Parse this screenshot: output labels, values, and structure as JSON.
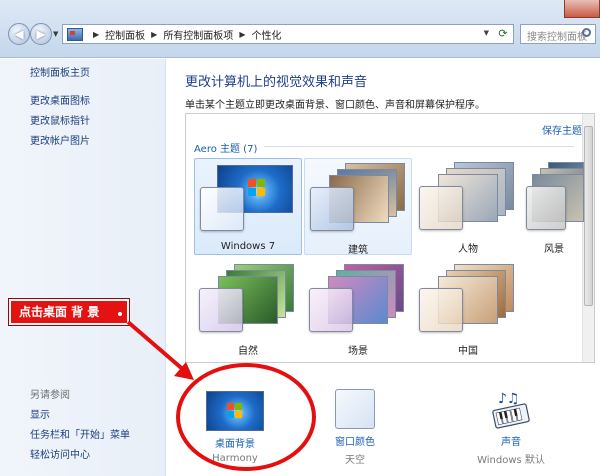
{
  "address_bar": {
    "breadcrumbs": [
      "控制面板",
      "所有控制面板项",
      "个性化"
    ],
    "search_placeholder": "搜索控制面板"
  },
  "sidebar": {
    "home_link": "控制面板主页",
    "links": [
      "更改桌面图标",
      "更改鼠标指针",
      "更改帐户图片"
    ],
    "see_also_title": "另请参阅",
    "see_also": [
      "显示",
      "任务栏和「开始」菜单",
      "轻松访问中心"
    ]
  },
  "main": {
    "heading": "更改计算机上的视觉效果和声音",
    "subheading": "单击某个主题立即更改桌面背景、窗口颜色、声音和屏幕保护程序。",
    "save_theme": "保存主题",
    "aero_label": "Aero 主题 (7)",
    "themes": [
      {
        "name": "Windows 7",
        "selected": true,
        "colors": [
          "#1d6cc8",
          "#54a6ee"
        ]
      },
      {
        "name": "建筑",
        "colors": [
          "#8a6a4a",
          "#d8c0a0"
        ]
      },
      {
        "name": "人物",
        "colors": [
          "#9aa7b8",
          "#e6d8c6"
        ]
      },
      {
        "name": "风景",
        "colors": [
          "#3a5a7a",
          "#c9c2b0"
        ]
      },
      {
        "name": "自然",
        "colors": [
          "#3a7a3a",
          "#9ad07a"
        ]
      },
      {
        "name": "场景",
        "colors": [
          "#6a4a8a",
          "#d08ac0"
        ]
      },
      {
        "name": "中国",
        "colors": [
          "#c08a5a",
          "#f0e0c8"
        ]
      }
    ]
  },
  "bottom": {
    "desktop_background": {
      "label": "桌面背景",
      "value": "Harmony"
    },
    "window_color": {
      "label": "窗口颜色",
      "value": "天空"
    },
    "sounds": {
      "label": "声音",
      "value": "Windows 默认"
    }
  },
  "annotation": {
    "callout_text": "点击桌面 背 景",
    "color": "#e51212"
  }
}
